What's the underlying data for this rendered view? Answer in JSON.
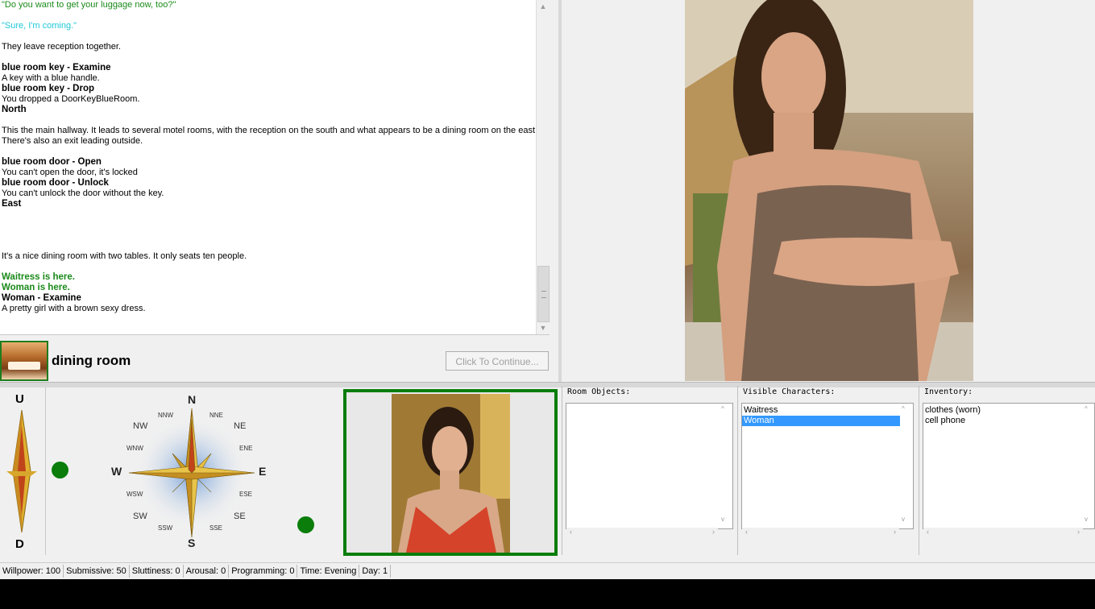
{
  "log": {
    "lines": [
      {
        "text": "\"Do you want to get your luggage now, too?\"",
        "style": "green"
      },
      {
        "text": "",
        "style": "gap"
      },
      {
        "text": "\"Sure, I'm coming.\"",
        "style": "cyan"
      },
      {
        "text": "",
        "style": "gap"
      },
      {
        "text": "They leave reception together.",
        "style": "normal"
      },
      {
        "text": "",
        "style": "gap"
      },
      {
        "text": "blue room key - Examine",
        "style": "bold"
      },
      {
        "text": "A key with a blue handle.",
        "style": "normal"
      },
      {
        "text": "blue room key - Drop",
        "style": "bold"
      },
      {
        "text": "You dropped a DoorKeyBlueRoom.",
        "style": "normal"
      },
      {
        "text": "North",
        "style": "bold"
      },
      {
        "text": "",
        "style": "gap"
      },
      {
        "text": "This the main hallway. It leads to several motel rooms, with the reception on the south and what appears to be a dining room on the east.",
        "style": "normal"
      },
      {
        "text": "There's also an exit leading outside.",
        "style": "normal"
      },
      {
        "text": "",
        "style": "gap"
      },
      {
        "text": "blue room door - Open",
        "style": "bold"
      },
      {
        "text": "You can't open the door, it's locked",
        "style": "normal"
      },
      {
        "text": "blue room door - Unlock",
        "style": "bold"
      },
      {
        "text": "You can't unlock the door without the key.",
        "style": "normal"
      },
      {
        "text": "East",
        "style": "bold"
      },
      {
        "text": "",
        "style": "gap"
      },
      {
        "text": "",
        "style": "gap"
      },
      {
        "text": "",
        "style": "gap"
      },
      {
        "text": "",
        "style": "gap"
      },
      {
        "text": "It's a nice dining room with two tables. It only seats ten people.",
        "style": "normal"
      },
      {
        "text": "",
        "style": "gap"
      },
      {
        "text": "Waitress is here.",
        "style": "greenb"
      },
      {
        "text": "Woman is here.",
        "style": "greenb"
      },
      {
        "text": "Woman - Examine",
        "style": "bold"
      },
      {
        "text": "A pretty girl with a brown sexy dress.",
        "style": "normal"
      }
    ]
  },
  "location": {
    "name": "dining room"
  },
  "continue_button": {
    "label": "Click To Continue..."
  },
  "nav": {
    "up": "U",
    "down": "D",
    "n": "N",
    "s": "S",
    "e": "E",
    "w": "W",
    "ne": "NE",
    "nw": "NW",
    "se": "SE",
    "sw": "SW",
    "nne": "NNE",
    "nnw": "NNW",
    "ene": "ENE",
    "ese": "ESE",
    "wnw": "WNW",
    "wsw": "WSW",
    "ssw": "SSW",
    "sse": "SSE"
  },
  "panels": {
    "room_objects": {
      "title": "Room Objects:",
      "items": []
    },
    "visible_characters": {
      "title": "Visible Characters:",
      "items": [
        "Waitress",
        "Woman"
      ],
      "selected": "Woman"
    },
    "inventory": {
      "title": "Inventory:",
      "items": [
        "clothes (worn)",
        "cell phone"
      ]
    }
  },
  "status": {
    "willpower": "Willpower: 100",
    "submissive": "Submissive: 50",
    "sluttiness": "Sluttiness: 0",
    "arousal": "Arousal: 0",
    "programming": "Programming: 0",
    "time": "Time: Evening",
    "day": "Day: 1"
  },
  "colors": {
    "accent_green": "#0a7d0a",
    "selection": "#3399ff",
    "text_green": "#1a8a1a",
    "text_cyan": "#1ec8d8"
  }
}
